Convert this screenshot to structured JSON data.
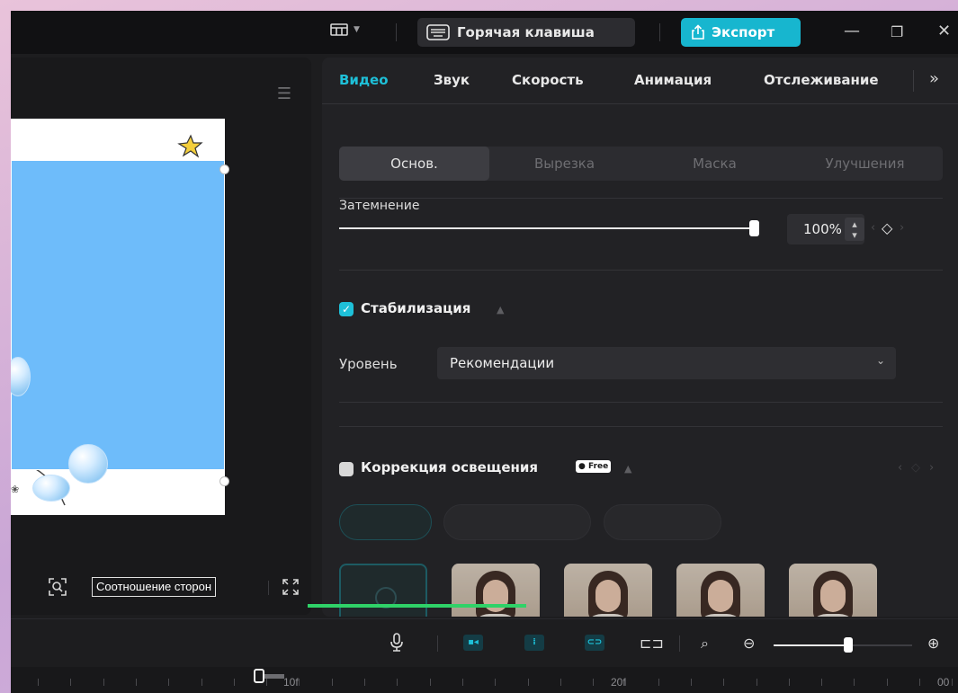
{
  "titlebar": {
    "layout_icon": "layout-icon",
    "hotkey_label": "Горячая клавиша",
    "export_label": "Экспорт",
    "minimize": "—",
    "restore": "❐",
    "close": "✕"
  },
  "preview": {
    "aspect_label": "Соотношение сторон"
  },
  "inspector": {
    "tabs": [
      "Видео",
      "Звук",
      "Скорость",
      "Анимация",
      "Отслеживание"
    ],
    "more": "»",
    "subtabs": [
      "Основ.",
      "Вырезка",
      "Маска",
      "Улучшения"
    ],
    "opacity_label": "Затемнение",
    "opacity_value": "100%",
    "opacity_level": 1.0,
    "stabilization_label": "Стабилизация",
    "stabilization_checked": true,
    "level_label": "Уровень",
    "level_value": "Рекомендации",
    "lighting_label": "Коррекция освещения",
    "lighting_checked": false,
    "free_badge": "Free"
  },
  "toolbar": {
    "zoom_level": 0.55
  },
  "ruler": {
    "labels": [
      "10f",
      "20f",
      "00"
    ]
  },
  "colors": {
    "accent": "#1ec0d8",
    "export_bg": "#17b6cf",
    "preview_blue": "#6ebcfa",
    "green_line": "#2fd268"
  }
}
